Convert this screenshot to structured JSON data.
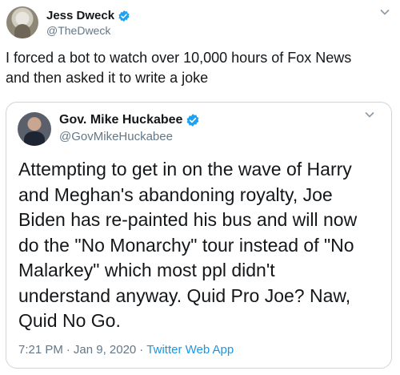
{
  "outer_tweet": {
    "name": "Jess Dweck",
    "handle": "@TheDweck",
    "text": "I forced a bot to watch over 10,000 hours of Fox News\nand then asked it to write a joke",
    "menu_icon": "chevron-down-icon"
  },
  "quoted_tweet": {
    "name": "Gov. Mike Huckabee",
    "handle": "@GovMikeHuckabee",
    "text": "Attempting to get in on the wave of Harry\nand Meghan's abandoning royalty, Joe\nBiden has re-painted his bus and will now\ndo the \"No Monarchy\" tour instead of \"No\nMalarkey\" which most ppl didn't\nunderstand anyway.  Quid Pro Joe?  Naw,\nQuid No Go.",
    "time": "7:21 PM",
    "date": "Jan 9, 2020",
    "sep": "·",
    "source": "Twitter Web App",
    "menu_icon": "chevron-down-icon"
  },
  "colors": {
    "verified_blue": "#1da1f2",
    "link_blue": "#1b95e0",
    "secondary_text": "#657786",
    "border": "#ccd6dd"
  }
}
